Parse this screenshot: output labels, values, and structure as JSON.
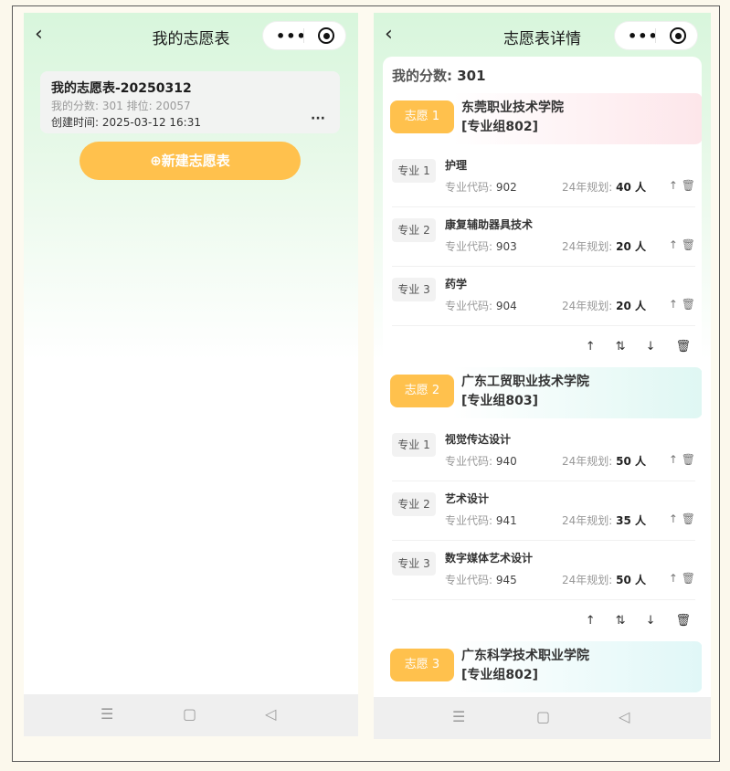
{
  "left": {
    "nav_title": "我的志愿表",
    "back_glyph": "‹",
    "capsule_dots": "•••",
    "card": {
      "title": "我的志愿表-20250312",
      "score_rank": "我的分数: 301 排位: 20057",
      "created": "创建时间: 2025-03-12 16:31",
      "more": "···"
    },
    "new_button": "⊕新建志愿表"
  },
  "right": {
    "nav_title": "志愿表详情",
    "back_glyph": "‹",
    "capsule_dots": "•••",
    "score_label": "我的分数:",
    "score_value": "301",
    "code_label": "专业代码:",
    "plan_label": "24年规划:",
    "schools": [
      {
        "tag": "志愿 1",
        "name": "东莞职业技术学院",
        "group": "[专业组802]",
        "majors": [
          {
            "tag": "专业 1",
            "name": "护理",
            "code": "902",
            "plan": "40 人"
          },
          {
            "tag": "专业 2",
            "name": "康复辅助器具技术",
            "code": "903",
            "plan": "20 人"
          },
          {
            "tag": "专业 3",
            "name": "药学",
            "code": "904",
            "plan": "20 人"
          }
        ]
      },
      {
        "tag": "志愿 2",
        "name": "广东工贸职业技术学院",
        "group": "[专业组803]",
        "majors": [
          {
            "tag": "专业 1",
            "name": "视觉传达设计",
            "code": "940",
            "plan": "50 人"
          },
          {
            "tag": "专业 2",
            "name": "艺术设计",
            "code": "941",
            "plan": "35 人"
          },
          {
            "tag": "专业 3",
            "name": "数字媒体艺术设计",
            "code": "945",
            "plan": "50 人"
          }
        ]
      },
      {
        "tag": "志愿 3",
        "name": "广东科学技术职业学院",
        "group": "[专业组802]",
        "majors": []
      }
    ]
  },
  "icons": {
    "up": "↑",
    "swap": "⇅",
    "down": "↓",
    "trash": "🗑",
    "menu": "☰",
    "home": "▢",
    "nav_back": "◁"
  },
  "colors": {
    "accent": "#ffc14d",
    "header_green": "#d8f6dc"
  }
}
